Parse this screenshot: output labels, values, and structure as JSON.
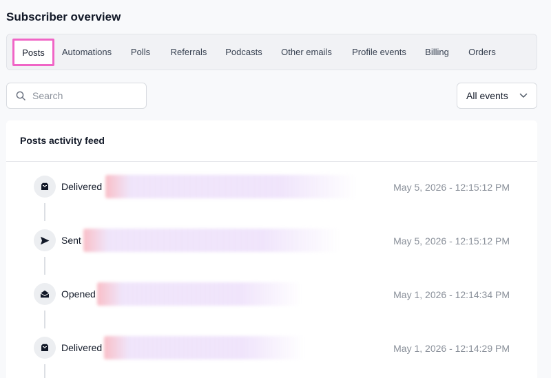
{
  "page": {
    "title": "Subscriber overview"
  },
  "tabs": [
    {
      "label": "Posts",
      "active": true
    },
    {
      "label": "Automations",
      "active": false
    },
    {
      "label": "Polls",
      "active": false
    },
    {
      "label": "Referrals",
      "active": false
    },
    {
      "label": "Podcasts",
      "active": false
    },
    {
      "label": "Other emails",
      "active": false
    },
    {
      "label": "Profile events",
      "active": false
    },
    {
      "label": "Billing",
      "active": false
    },
    {
      "label": "Orders",
      "active": false
    }
  ],
  "filters": {
    "search_placeholder": "Search",
    "search_icon": "search-icon",
    "event_select": {
      "selected": "All events",
      "icon": "chevron-down-icon"
    }
  },
  "feed": {
    "title": "Posts activity feed",
    "items": [
      {
        "event": "Delivered",
        "icon": "inbox-tray-icon",
        "timestamp": "May 5, 2026 - 12:15:12 PM",
        "details_redacted": true
      },
      {
        "event": "Sent",
        "icon": "send-icon",
        "timestamp": "May 5, 2026 - 12:15:12 PM",
        "details_redacted": true
      },
      {
        "event": "Opened",
        "icon": "open-envelope-icon",
        "timestamp": "May 1, 2026 - 12:14:34 PM",
        "details_redacted": true
      },
      {
        "event": "Delivered",
        "icon": "inbox-tray-icon",
        "timestamp": "May 1, 2026 - 12:14:29 PM",
        "details_redacted": true
      }
    ]
  },
  "colors": {
    "page_bg": "#f8f9fb",
    "active_tab_outline": "#f065c6",
    "muted_text": "#8a909a",
    "primary_text": "#111827"
  }
}
